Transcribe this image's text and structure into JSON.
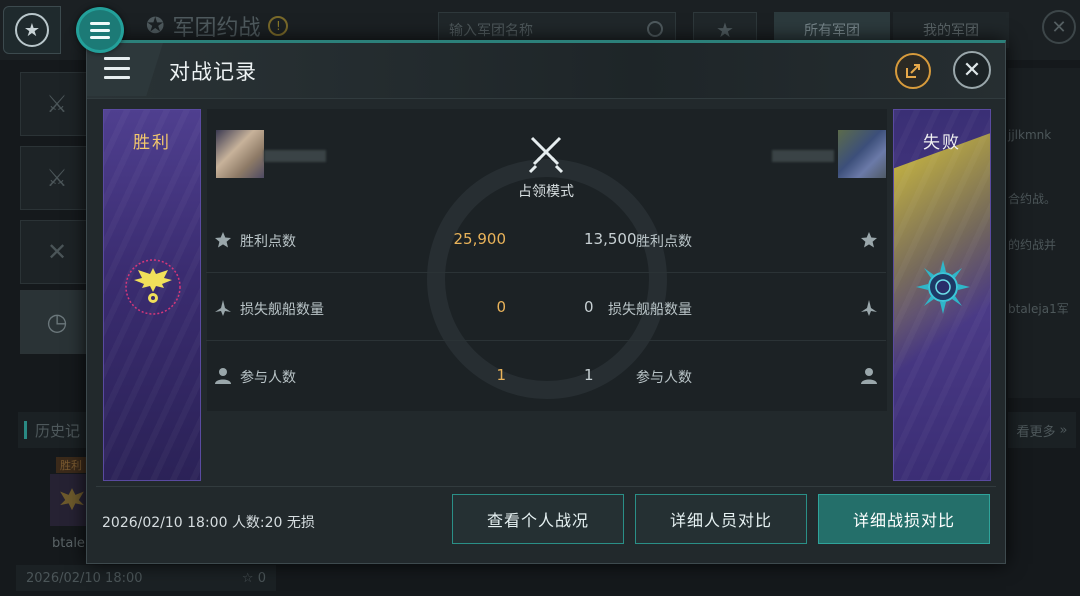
{
  "background": {
    "title": "军团约战",
    "search_placeholder": "输入军团名称",
    "tabs": [
      "所有军团",
      "我的军团"
    ],
    "history_label": "历史记",
    "more_label": "看更多",
    "card": {
      "badge": "胜利",
      "name": "btale",
      "date": "2026/02/10 18:00",
      "stars": "0"
    },
    "right_snippets": [
      "jjlkmnk",
      "合约战。",
      "的约战并",
      "btaleja1军"
    ]
  },
  "modal": {
    "title": "对战记录",
    "winner_label": "胜利",
    "loser_label": "失败",
    "mode_label": "占领模式",
    "stats": [
      {
        "label": "胜利点数",
        "icon": "star-icon",
        "winner_value": "25,900",
        "loser_value": "13,500"
      },
      {
        "label": "损失舰船数量",
        "icon": "ship-icon",
        "winner_value": "0",
        "loser_value": "0"
      },
      {
        "label": "参与人数",
        "icon": "person-icon",
        "winner_value": "1",
        "loser_value": "1"
      }
    ],
    "footer_info": "2026/02/10 18:00 人数:20 无损",
    "buttons": {
      "personal": "查看个人战况",
      "members": "详细人员对比",
      "losses": "详细战损对比"
    }
  },
  "colors": {
    "accent": "#2c807a",
    "win_gold": "#e9b35a",
    "banner_purple": "#3a2c70",
    "share_orange": "#d79b3c"
  }
}
